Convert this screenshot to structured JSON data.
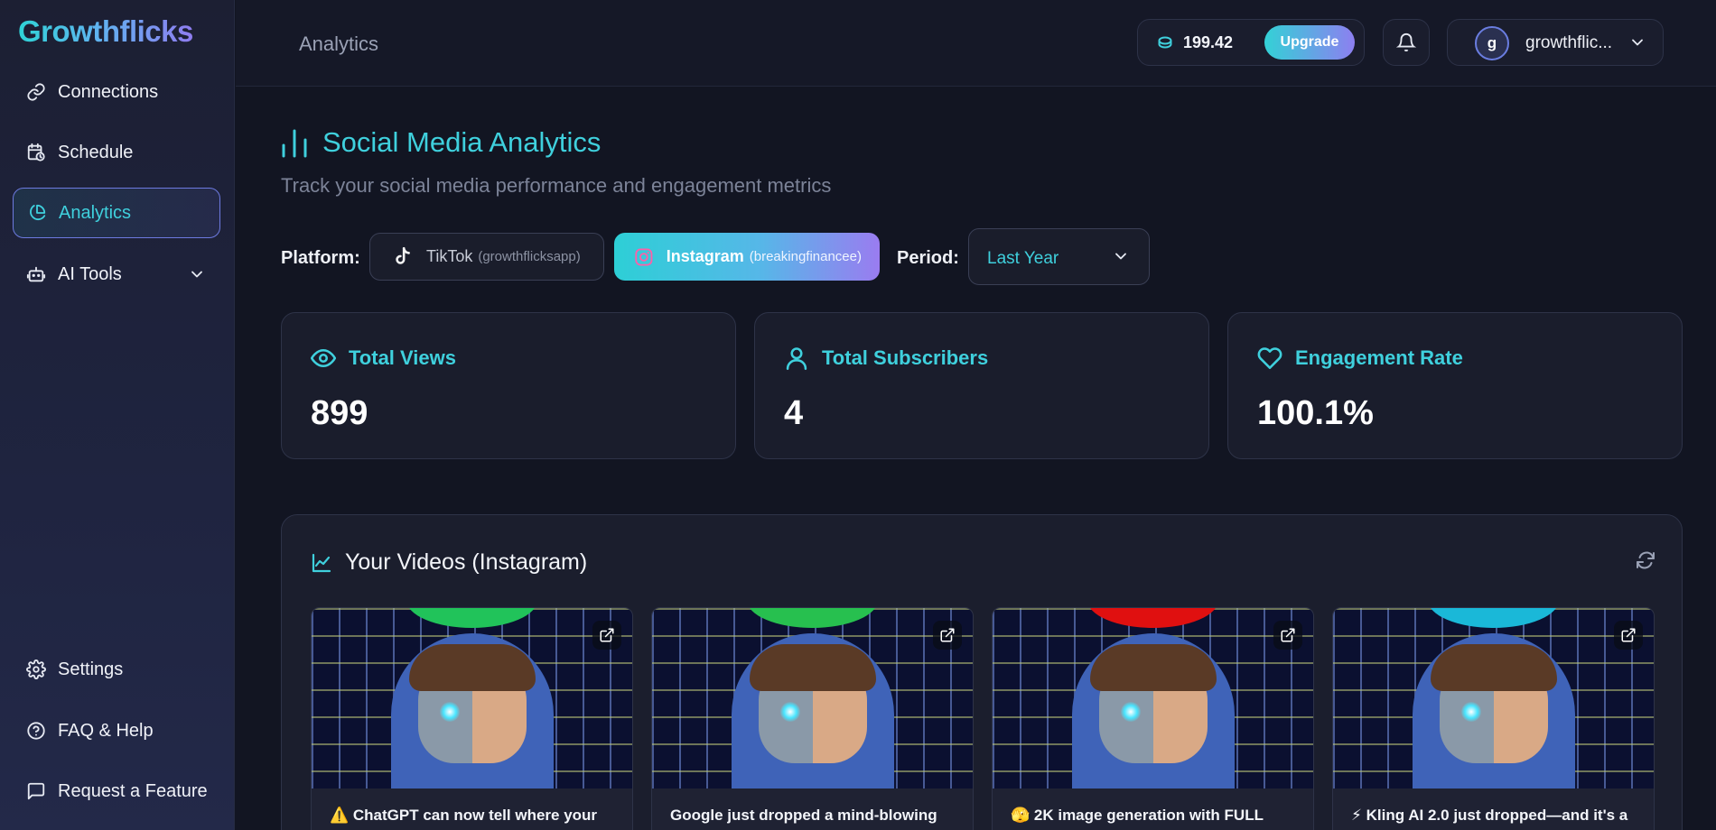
{
  "app": {
    "brand": "Growthflicks"
  },
  "sidebar": {
    "top_items": [
      {
        "label": "Connections",
        "icon": "link-icon"
      },
      {
        "label": "Schedule",
        "icon": "calendar-clock-icon"
      },
      {
        "label": "Analytics",
        "icon": "pie-chart-icon",
        "active": true
      },
      {
        "label": "AI Tools",
        "icon": "bot-icon",
        "expandable": true
      }
    ],
    "bottom_items": [
      {
        "label": "Settings",
        "icon": "gear-icon"
      },
      {
        "label": "FAQ & Help",
        "icon": "help-circle-icon"
      },
      {
        "label": "Request a Feature",
        "icon": "message-square-icon"
      }
    ]
  },
  "header": {
    "breadcrumb": "Analytics",
    "credits": "199.42",
    "upgrade_label": "Upgrade",
    "user_initial": "g",
    "username": "growthflic..."
  },
  "main": {
    "title": "Social Media Analytics",
    "subtitle": "Track your social media performance and engagement metrics",
    "platform_label": "Platform:",
    "platforms": [
      {
        "name": "TikTok",
        "handle": "(growthflicksapp)",
        "selected": false
      },
      {
        "name": "Instagram",
        "handle": "(breakingfinancee)",
        "selected": true
      }
    ],
    "period_label": "Period:",
    "period_value": "Last Year",
    "stats": [
      {
        "label": "Total Views",
        "value": "899",
        "icon": "eye-icon"
      },
      {
        "label": "Total Subscribers",
        "value": "4",
        "icon": "user-icon"
      },
      {
        "label": "Engagement Rate",
        "value": "100.1%",
        "icon": "heart-icon"
      }
    ],
    "videos": {
      "title": "Your Videos (Instagram)",
      "items": [
        {
          "title": "⚠️ ChatGPT can now tell where your",
          "accent": "#21c35a"
        },
        {
          "title": "Google just dropped a mind-blowing",
          "accent": "#27c04f"
        },
        {
          "title": "🫣 2K image generation with FULL",
          "accent": "#e01010"
        },
        {
          "title": "⚡ Kling AI 2.0 just dropped—and it's a",
          "accent": "#1ab8d8"
        }
      ]
    }
  },
  "colors": {
    "accent_cyan": "#3fd0dd",
    "accent_purple": "#8d7ff0",
    "background": "#121522"
  }
}
